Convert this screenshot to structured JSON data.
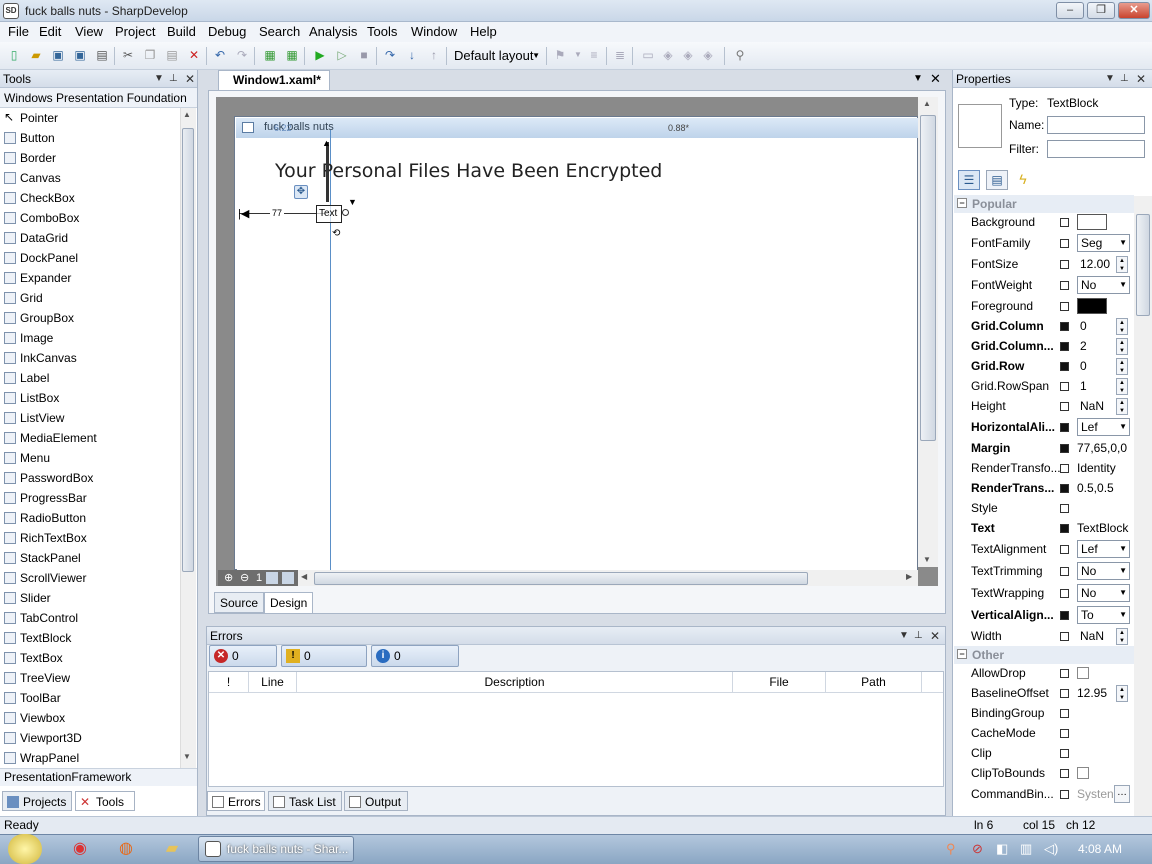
{
  "window": {
    "title": "fuck balls nuts - SharpDevelop",
    "app_icon": "SD"
  },
  "menu": [
    "File",
    "Edit",
    "View",
    "Project",
    "Build",
    "Debug",
    "Search",
    "Analysis",
    "Tools",
    "Window",
    "Help"
  ],
  "toolbar": {
    "layout_label": "Default layout"
  },
  "tools_panel": {
    "title": "Tools",
    "category_top": "Windows Presentation Foundation",
    "items": [
      "Pointer",
      "Button",
      "Border",
      "Canvas",
      "CheckBox",
      "ComboBox",
      "DataGrid",
      "DockPanel",
      "Expander",
      "Grid",
      "GroupBox",
      "Image",
      "InkCanvas",
      "Label",
      "ListBox",
      "ListView",
      "MediaElement",
      "Menu",
      "PasswordBox",
      "ProgressBar",
      "RadioButton",
      "RichTextBox",
      "StackPanel",
      "ScrollViewer",
      "Slider",
      "TabControl",
      "TextBlock",
      "TextBox",
      "TreeView",
      "ToolBar",
      "Viewbox",
      "Viewport3D",
      "WrapPanel"
    ],
    "category_bottom": "PresentationFramework",
    "tabs": [
      "Projects",
      "Tools"
    ]
  },
  "document": {
    "tab_label": "Window1.xaml*",
    "window_caption": "fuck balls nuts",
    "overlay_label": "6.22",
    "ratio_label": "0.88*",
    "heading": "Your Personal Files Have Been Encrypted",
    "margin_label": "77",
    "selected_text": "Text",
    "zoom_label": "1",
    "subtabs": [
      "Source",
      "Design"
    ]
  },
  "errors_panel": {
    "title": "Errors",
    "filters": [
      "0 Errors",
      "0 Warnings",
      "0 Messages"
    ],
    "columns": [
      "!",
      "Line",
      "Description",
      "File",
      "Path"
    ],
    "tabs": [
      "Errors",
      "Task List",
      "Output"
    ]
  },
  "properties": {
    "title": "Properties",
    "type_label": "Type:",
    "type_value": "TextBlock",
    "name_label": "Name:",
    "filter_label": "Filter:",
    "categories": [
      "Popular",
      "Other"
    ],
    "rows": [
      {
        "name": "Background",
        "bold": false,
        "set": false,
        "value": ""
      },
      {
        "name": "FontFamily",
        "bold": false,
        "set": false,
        "value": "Seg"
      },
      {
        "name": "FontSize",
        "bold": false,
        "set": false,
        "value": "12.00"
      },
      {
        "name": "FontWeight",
        "bold": false,
        "set": false,
        "value": "No"
      },
      {
        "name": "Foreground",
        "bold": false,
        "set": false,
        "value": ""
      },
      {
        "name": "Grid.Column",
        "bold": true,
        "set": true,
        "value": "0"
      },
      {
        "name": "Grid.Column...",
        "bold": true,
        "set": true,
        "value": "2"
      },
      {
        "name": "Grid.Row",
        "bold": true,
        "set": true,
        "value": "0"
      },
      {
        "name": "Grid.RowSpan",
        "bold": false,
        "set": false,
        "value": "1"
      },
      {
        "name": "Height",
        "bold": false,
        "set": false,
        "value": "NaN"
      },
      {
        "name": "HorizontalAli...",
        "bold": true,
        "set": true,
        "value": "Lef"
      },
      {
        "name": "Margin",
        "bold": true,
        "set": true,
        "value": "77,65,0,0"
      },
      {
        "name": "RenderTransfo...",
        "bold": false,
        "set": false,
        "value": "Identity"
      },
      {
        "name": "RenderTrans...",
        "bold": true,
        "set": true,
        "value": "0.5,0.5"
      },
      {
        "name": "Style",
        "bold": false,
        "set": false,
        "value": ""
      },
      {
        "name": "Text",
        "bold": true,
        "set": true,
        "value": "TextBlock"
      },
      {
        "name": "TextAlignment",
        "bold": false,
        "set": false,
        "value": "Lef"
      },
      {
        "name": "TextTrimming",
        "bold": false,
        "set": false,
        "value": "No"
      },
      {
        "name": "TextWrapping",
        "bold": false,
        "set": false,
        "value": "No"
      },
      {
        "name": "VerticalAlign...",
        "bold": true,
        "set": true,
        "value": "To"
      },
      {
        "name": "Width",
        "bold": false,
        "set": false,
        "value": "NaN"
      }
    ],
    "other_rows": [
      {
        "name": "AllowDrop",
        "value": ""
      },
      {
        "name": "BaselineOffset",
        "value": "12.95"
      },
      {
        "name": "BindingGroup",
        "value": ""
      },
      {
        "name": "CacheMode",
        "value": ""
      },
      {
        "name": "Clip",
        "value": ""
      },
      {
        "name": "ClipToBounds",
        "value": ""
      },
      {
        "name": "CommandBin...",
        "value": "Systen"
      }
    ]
  },
  "statusbar": {
    "left": "Ready",
    "line": "ln 6",
    "col": "col 15",
    "ch": "ch 12"
  },
  "taskbar": {
    "task_label": "fuck balls nuts - Shar...",
    "clock": "4:08 AM"
  }
}
